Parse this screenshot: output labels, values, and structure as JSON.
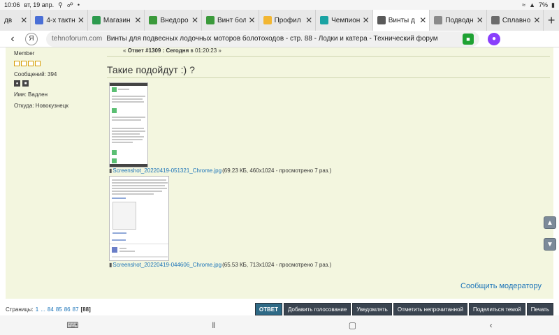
{
  "status_bar": {
    "time": "10:06",
    "date": "вт, 19 апр.",
    "battery": "7%"
  },
  "tabs": [
    {
      "title": "дв",
      "favicon": "tab-icon",
      "color": "#999999"
    },
    {
      "title": "4-х тактн",
      "favicon": "tab-icon",
      "color": "#4a6fd6"
    },
    {
      "title": "Магазин",
      "favicon": "tab-icon",
      "color": "#2c9a4d"
    },
    {
      "title": "Внедоро",
      "favicon": "tab-icon",
      "color": "#3b9a3b"
    },
    {
      "title": "Винт бол",
      "favicon": "tab-icon",
      "color": "#3b9a3b"
    },
    {
      "title": "Профил",
      "favicon": "tab-icon",
      "color": "#f2b632"
    },
    {
      "title": "Чемпион",
      "favicon": "tab-icon",
      "color": "#1aa3a3"
    },
    {
      "title": "Винты д",
      "favicon": "tab-icon",
      "color": "#5a5a5a"
    },
    {
      "title": "Подводн",
      "favicon": "tab-icon",
      "color": "#8a8a8a"
    },
    {
      "title": "Сплавно",
      "favicon": "tab-icon",
      "color": "#6b6b6b"
    }
  ],
  "address": {
    "domain": "tehnoforum.com",
    "title": "Винты для подвесных лодочных моторов болотоходов - стр. 88 - Лодки и катера - Технический форум"
  },
  "post": {
    "header_prefix": "«",
    "header_number": "Ответ #1309 : Сегодня",
    "header_time": "в 01:20:23",
    "header_suffix": "»",
    "title": "Такие подойдут :) ?",
    "report_link": "Сообщить модератору"
  },
  "user": {
    "rank": "Member",
    "posts": "Сообщений: 394",
    "name": "Имя: Вадлен",
    "location": "Откуда: Новокузнецк"
  },
  "attachments": [
    {
      "filename": "Screenshot_20220419-051321_Chrome.jpg",
      "info": "(69.23 КБ, 460x1024 - просмотрено 7 раз.)"
    },
    {
      "filename": "Screenshot_20220419-044606_Chrome.jpg",
      "info": "(65.53 КБ, 713x1024 - просмотрено 7 раз.)"
    }
  ],
  "pager": {
    "label": "Страницы:",
    "first": "1",
    "ellipsis": "...",
    "pages": [
      "84",
      "85",
      "86",
      "87"
    ],
    "current": "[88]"
  },
  "actions": [
    {
      "label": "ОТВЕТ",
      "primary": true
    },
    {
      "label": "Добавить голосование",
      "primary": false
    },
    {
      "label": "Уведомлять",
      "primary": false
    },
    {
      "label": "Отметить непрочитанной",
      "primary": false
    },
    {
      "label": "Поделиться темой",
      "primary": false
    },
    {
      "label": "Печать",
      "primary": false
    }
  ]
}
